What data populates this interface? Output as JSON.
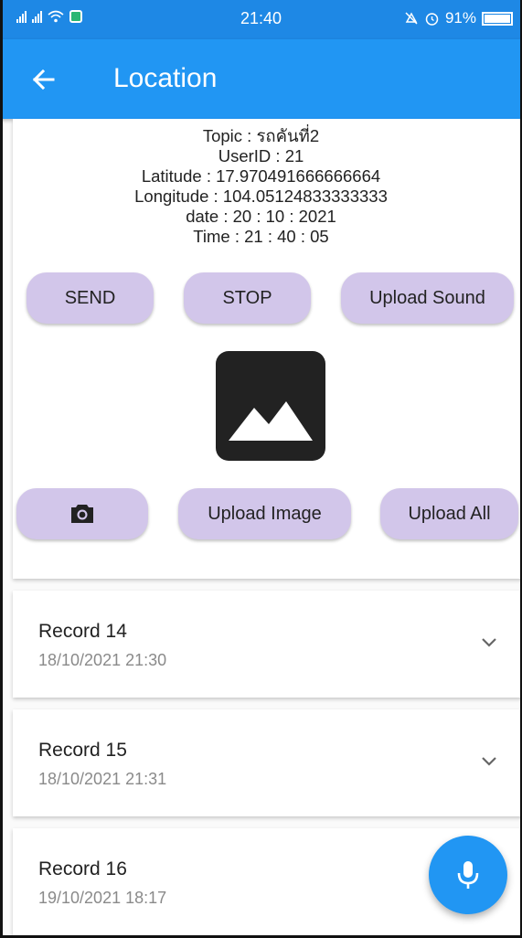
{
  "status_bar": {
    "time": "21:40",
    "battery": "91%",
    "icons": [
      "signal-icon",
      "wifi-icon",
      "app-notification-icon",
      "mute-icon",
      "alarm-icon",
      "battery-icon"
    ]
  },
  "app_bar": {
    "title": "Location",
    "back_icon": "arrow-back-icon"
  },
  "info": {
    "topic": "Topic : รถคันที่2",
    "user_id": "UserID : 21",
    "latitude": "Latitude : 17.970491666666664",
    "longitude": "Longitude : 104.05124833333333",
    "date": "date : 20 : 10 : 2021",
    "time": "Time : 21 : 40 : 05"
  },
  "actions": {
    "send": "SEND",
    "stop": "STOP",
    "upload_sound": "Upload Sound",
    "camera_icon": "camera-icon",
    "upload_image": "Upload Image",
    "upload_all": "Upload All"
  },
  "image_placeholder_icon": "image-icon",
  "records": [
    {
      "title": "Record 14",
      "date": "18/10/2021 21:30"
    },
    {
      "title": "Record 15",
      "date": "18/10/2021 21:31"
    },
    {
      "title": "Record 16",
      "date": "19/10/2021 18:17"
    }
  ],
  "fab_icon": "microphone-icon",
  "colors": {
    "primary": "#2196f3",
    "status_bar": "#1e88e5",
    "button": "#d2c6ea",
    "secondary_text": "#8a8a8a"
  }
}
